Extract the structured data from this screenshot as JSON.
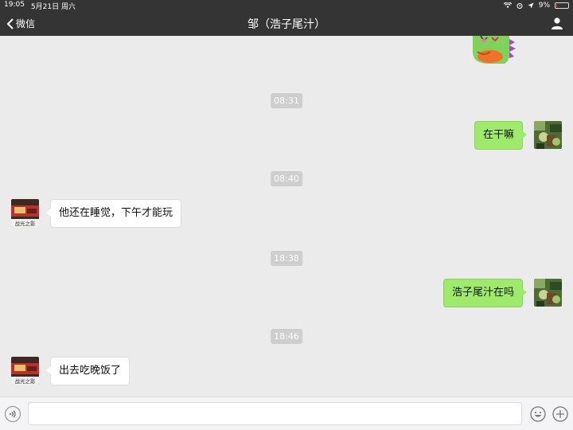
{
  "status": {
    "time": "19:05",
    "date": "5月21日 周六",
    "battery": "9%",
    "battery_level": 0.09
  },
  "nav": {
    "back_label": "微信",
    "title": "邹（浩子尾汁）"
  },
  "messages": [
    {
      "type": "timestamp",
      "text": "08:31"
    },
    {
      "type": "outgoing",
      "text": "在干嘛"
    },
    {
      "type": "timestamp",
      "text": "08:40"
    },
    {
      "type": "incoming",
      "text": "他还在睡觉，下午才能玩",
      "avatar_caption": "战光之影"
    },
    {
      "type": "timestamp",
      "text": "18:38"
    },
    {
      "type": "outgoing",
      "text": "浩子尾汁在吗"
    },
    {
      "type": "timestamp",
      "text": "18:46"
    },
    {
      "type": "incoming",
      "text": "出去吃晚饭了",
      "avatar_caption": "战光之影"
    }
  ],
  "input": {
    "placeholder": ""
  },
  "colors": {
    "bar": "#343434",
    "chat_bg": "#ebebeb",
    "outgoing_bubble": "#9eea6a",
    "incoming_bubble": "#ffffff",
    "timestamp_bg": "#cecece",
    "battery": "#e64340"
  },
  "icons": {
    "back": "chevron-left-icon",
    "profile": "person-icon",
    "voice": "voice-icon",
    "emoji": "smiley-icon",
    "more": "plus-icon"
  }
}
